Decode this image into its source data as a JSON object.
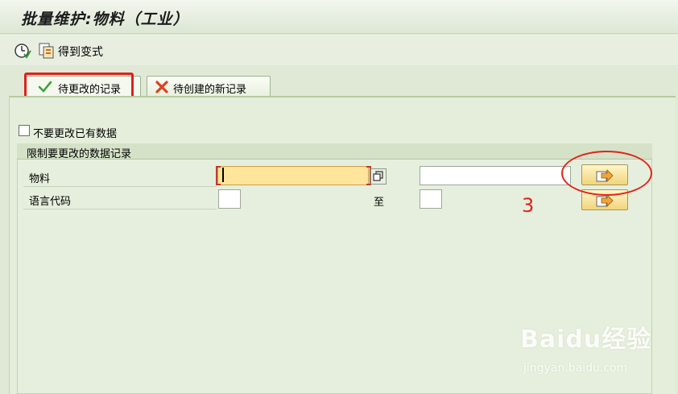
{
  "title": "批量维护:物料（工业）",
  "toolbar": {
    "variant_label": "得到变式"
  },
  "tabs": [
    {
      "label": "待更改的记录",
      "active": true
    },
    {
      "label": "待创建的新记录",
      "active": false
    }
  ],
  "options": {
    "no_change_existing_label": "不要更改已有数据"
  },
  "restrict_group": {
    "title": "限制要更改的数据记录",
    "rows": [
      {
        "label": "物料",
        "from_value": "",
        "to_value": ""
      },
      {
        "label": "语言代码",
        "from_value": "",
        "to_label": "至",
        "to_value": ""
      }
    ]
  },
  "annotation": {
    "number": "3",
    "color": "#e2231a"
  },
  "watermark": {
    "logo": "Baidu经验",
    "url": "jingyan.baidu.com"
  },
  "colors": {
    "background": "#dfe9d6",
    "highlight": "#e0201b",
    "required_field": "#ffe49b"
  }
}
